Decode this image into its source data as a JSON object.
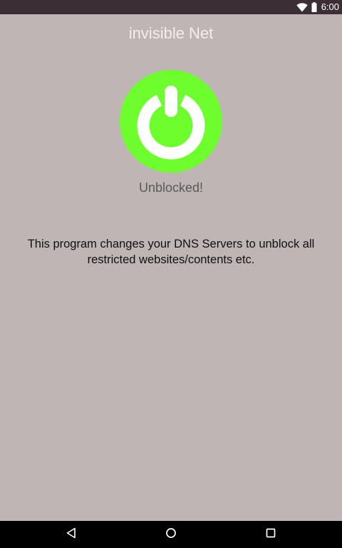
{
  "status_bar": {
    "time": "6:00",
    "icons": [
      "wifi-icon",
      "battery-icon"
    ]
  },
  "app": {
    "title": "invisible Net",
    "status": "Unblocked!",
    "description": "This program changes your DNS Servers to unblock all restricted websites/contents etc."
  },
  "power_button": {
    "icon": "power-icon",
    "state": "on",
    "color": "#6efe2d"
  },
  "navigation_bar": {
    "buttons": [
      "back-icon",
      "home-icon",
      "recents-icon"
    ]
  },
  "colors": {
    "background": "#c0b5b5",
    "status_bar": "#3c2e35",
    "title_text": "#f3eded",
    "power_on": "#6efe2d",
    "nav_bar": "#000000"
  }
}
